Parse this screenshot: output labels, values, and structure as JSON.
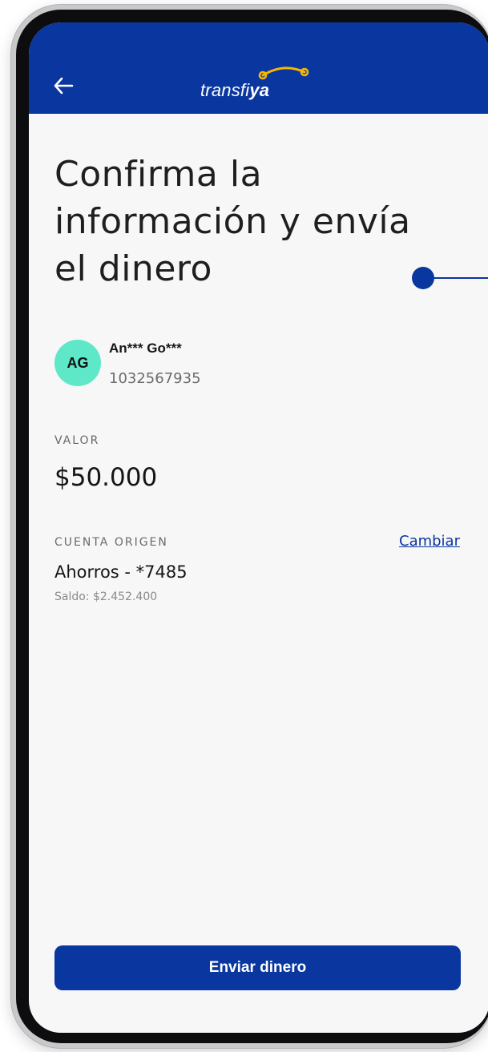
{
  "header": {
    "logo_text_main": "transfi",
    "logo_text_bold": "ya",
    "brand_color": "#0a36a0"
  },
  "title": {
    "line1": "Confirma la",
    "line2": "información y envía",
    "line3": "el dinero"
  },
  "contact": {
    "initials": "AG",
    "name": "An*** Go***",
    "id": "1032567935",
    "avatar_color": "#5ee8c8"
  },
  "amount": {
    "label": "VALOR",
    "value": "$50.000"
  },
  "origin_account": {
    "label": "CUENTA ORIGEN",
    "change_link": "Cambiar",
    "account": "Ahorros - *7485",
    "balance": "Saldo: $2.452.400"
  },
  "footer": {
    "send_button": "Enviar dinero"
  },
  "icons": {
    "back": "arrow-left-icon"
  }
}
